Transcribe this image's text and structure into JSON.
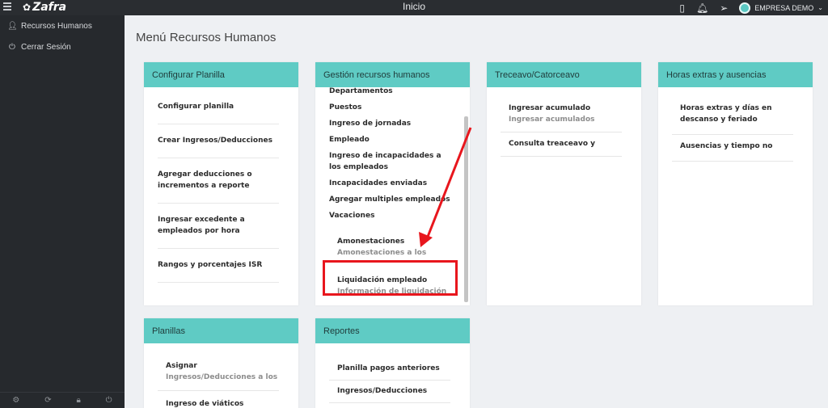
{
  "topbar": {
    "logo": "Zafra",
    "title": "Inicio",
    "company": "EMPRESA DEMO",
    "icons": [
      "menu-icon",
      "phone-icon",
      "bell-icon",
      "send-icon",
      "avatar",
      "chevron-down-icon"
    ]
  },
  "sidebar": {
    "items": [
      {
        "label": "Recursos Humanos",
        "icon": "user-icon"
      },
      {
        "label": "Cerrar Sesión",
        "icon": "power-icon"
      }
    ],
    "bottom_icons": [
      "gear-icon",
      "refresh-icon",
      "lock-icon",
      "power-icon"
    ]
  },
  "main": {
    "title": "Menú Recursos Humanos",
    "cards": {
      "config": {
        "title": "Configurar Planilla",
        "items": [
          "Configurar planilla",
          "Crear Ingresos/Deducciones",
          "Agregar deducciones o incrementos a reporte",
          "Ingresar excedente a empleados por hora",
          "Rangos y porcentajes ISR"
        ]
      },
      "gestion": {
        "title": "Gestión recursos humanos",
        "items": [
          "Departamentos",
          "Puestos",
          "Ingreso de jornadas",
          "Empleado",
          "Ingreso de incapacidades a los empleados",
          "Incapacidades enviadas",
          "Agregar multiples empleados",
          "Vacaciones"
        ],
        "amonestaciones": {
          "title": "Amonestaciones",
          "sub": "Amonestaciones a los"
        },
        "liquidacion": {
          "title": "Liquidación empleado",
          "sub": "Información de liquidación"
        }
      },
      "trece": {
        "title": "Treceavo/Catorceavo",
        "items": [
          {
            "title": "Ingresar acumulado",
            "sub": "Ingresar acumulados"
          },
          {
            "title": "Consulta treaceavo y",
            "sub": ""
          }
        ]
      },
      "horas": {
        "title": "Horas extras y ausencias",
        "items": [
          "Horas extras y días en descanso y feriado",
          "Ausencias y tiempo no"
        ]
      },
      "planillas": {
        "title": "Planillas",
        "items": [
          {
            "title": "Asignar",
            "sub": "Ingresos/Deducciones a los"
          },
          {
            "title": "Ingreso de viáticos",
            "sub": ""
          }
        ]
      },
      "reportes": {
        "title": "Reportes",
        "items": [
          "Planilla pagos anteriores",
          "Ingresos/Deducciones"
        ]
      }
    }
  },
  "colors": {
    "header_teal": "#5fcbc4",
    "sidebar_bg": "#26292d",
    "topbar_bg": "#2a2d31",
    "annotation_red": "#e8161d"
  }
}
